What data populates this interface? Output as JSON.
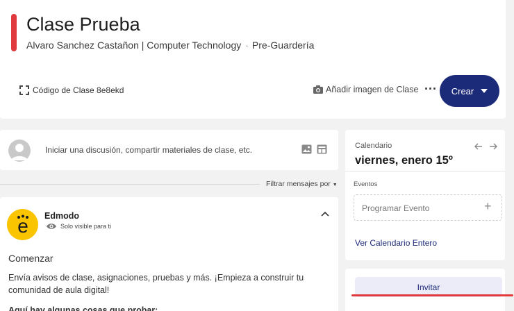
{
  "header": {
    "title": "Clase Prueba",
    "teacher": "Alvaro Sanchez Castañon | Computer Technology",
    "separator": "·",
    "grade": "Pre-Guardería",
    "class_code": "Código de Clase 8e8ekd",
    "add_image": "Añadir imagen de Clase",
    "more": "···",
    "create_label": "Crear",
    "accent_color": "#e0393e",
    "primary_color": "#1c2a7a"
  },
  "composer": {
    "placeholder": "Iniciar una discusión, compartir materiales de clase, etc."
  },
  "feed": {
    "filter_label": "Filtrar mensajes por"
  },
  "post": {
    "author": "Edmodo",
    "visibility": "Solo visible para ti",
    "heading": "Comenzar",
    "body": "Envía avisos de clase, asignaciones, pruebas y más. ¡Empieza a construir tu comunidad de aula digital!",
    "cut_line": "Aquí hay algunas cosas que probar:",
    "logo_color": "#fbc400"
  },
  "calendar": {
    "label": "Calendario",
    "date": "viernes, enero 15º",
    "events_label": "Eventos",
    "schedule_placeholder": "Programar Evento",
    "add_symbol": "+",
    "full_calendar_link": "Ver Calendario Entero"
  },
  "invite": {
    "label": "Invitar"
  }
}
